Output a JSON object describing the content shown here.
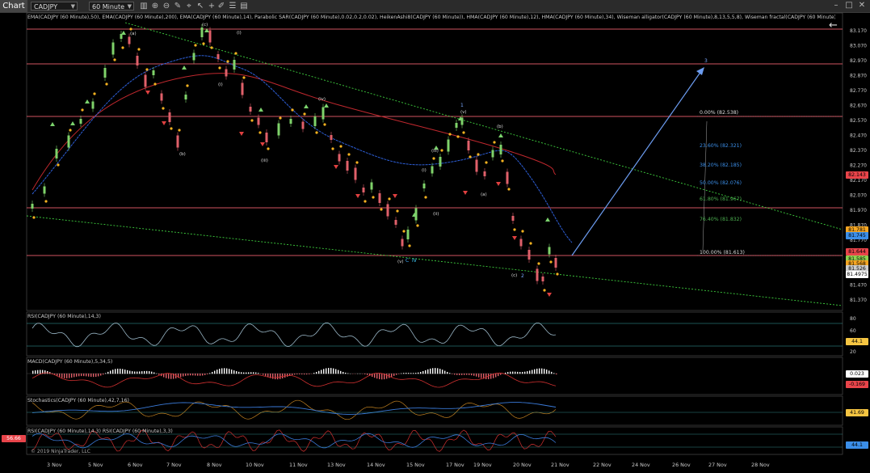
{
  "toolbar": {
    "tab_label": "Chart",
    "instrument": "CADJPY",
    "interval": "60 Minute",
    "icons": [
      "search-icon",
      "bar-type-icon",
      "zoom-in-icon",
      "zoom-out-icon",
      "drawing-tools-icon",
      "crosshair-icon",
      "cursor-icon",
      "plus-icon",
      "pencil-icon",
      "hand-icon",
      "properties-icon"
    ],
    "window_buttons": [
      "minimize-icon",
      "restore-icon",
      "close-icon"
    ]
  },
  "header": {
    "indicators": "EMA(CADJPY (60 Minute),50), EMA(CADJPY (60 Minute),200), EMA(CADJPY (60 Minute),14), Parabolic SAR(CADJPY (60 Minute),0.02,0.2,0.02), HeikenAshi8(CADJPY (60 Minute)), HMA(CADJPY (60 Minute),12), HMA(CADJPY (60 Minute),34), Wiseman alligator(CADJPY (60 Minute),8,13,5,5,8), Wiseman fractal(CADJPY (60 Minute),2,8)"
  },
  "price_axis": {
    "ticks": [
      "83.170",
      "83.070",
      "82.970",
      "82.870",
      "82.770",
      "82.670",
      "82.570",
      "82.470",
      "82.370",
      "82.270",
      "82.170",
      "82.070",
      "81.970",
      "81.870",
      "81.770",
      "81.670",
      "81.570",
      "81.470",
      "81.370"
    ]
  },
  "price_badges": [
    {
      "value": "82.143",
      "color": "#e8444a"
    },
    {
      "value": "81.781",
      "color": "#f5a623"
    },
    {
      "value": "81.745",
      "color": "#3b8ee8"
    },
    {
      "value": "81.644",
      "color": "#e8444a"
    },
    {
      "value": "81.585",
      "color": "#8fd14f"
    },
    {
      "value": "81.568",
      "color": "#f5a623"
    },
    {
      "value": "81.526",
      "color": "#cccccc"
    },
    {
      "value": "81.4975",
      "color": "#ffffff"
    }
  ],
  "fib_levels": [
    {
      "label": "0.00% (82.538)",
      "color": "#dddddd"
    },
    {
      "label": "23.60% (82.321)",
      "color": "#3b8ee8"
    },
    {
      "label": "38.20% (82.185)",
      "color": "#3b8ee8"
    },
    {
      "label": "50.00% (82.076)",
      "color": "#3b8ee8"
    },
    {
      "label": "61.80% (81.967)",
      "color": "#4caf50"
    },
    {
      "label": "76.40% (81.832)",
      "color": "#4caf50"
    },
    {
      "label": "100.00% (81.613)",
      "color": "#dddddd"
    }
  ],
  "wave_labels": {
    "a": "(a)",
    "b": "(b)",
    "i": "(i)",
    "ii": "(ii)",
    "iii": "(iii)",
    "iv": "(iv)",
    "v": "(v)",
    "c": "(c)",
    "w1": "1",
    "w2": "2",
    "w3": "3",
    "wc": "C",
    "wiv": "IV",
    "wii": "(ii)",
    "wi2": "(i)",
    "wv": "(v)",
    "wa": "(a)",
    "wb": "(b)"
  },
  "x_axis": [
    "3 Nov",
    "5 Nov",
    "6 Nov",
    "7 Nov",
    "8 Nov",
    "10 Nov",
    "11 Nov",
    "13 Nov",
    "14 Nov",
    "15 Nov",
    "17 Nov",
    "19 Nov",
    "20 Nov",
    "21 Nov",
    "22 Nov",
    "24 Nov",
    "26 Nov",
    "27 Nov",
    "28 Nov"
  ],
  "panels": {
    "rsi": {
      "label": "RSI(CADJPY (60 Minute),14,3)",
      "ticks": [
        "80",
        "60",
        "40",
        "20"
      ],
      "badge": "44.1"
    },
    "macd": {
      "label": "MACD(CADJPY (60 Minute),5,34,5)",
      "badge1": "0.023",
      "badge2": "-0.169"
    },
    "stoch": {
      "label": "Stochastics(CADJPY (60 Minute),42,7,16)",
      "badge": "41.69"
    },
    "rsi2": {
      "label": "RSI(CADJPY (60 Minute),14,3)  RSI(CADJPY (60 Minute),3,3)",
      "badge_left": "56.66",
      "badge": "44.1"
    }
  },
  "copyright": "© 2019 NinjaTrader, LLC"
}
